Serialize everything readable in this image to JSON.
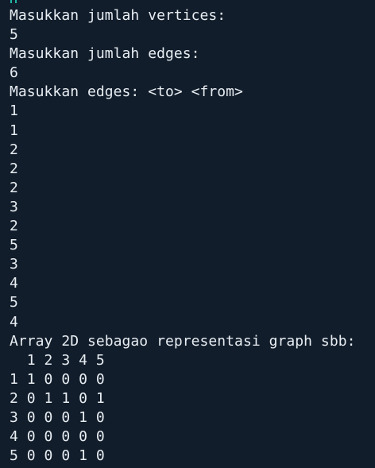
{
  "terminal": {
    "lines": [
      "Masukkan jumlah vertices:",
      "5",
      "Masukkan jumlah edges:",
      "6",
      "Masukkan edges: <to> <from>",
      "1",
      "1",
      "2",
      "2",
      "2",
      "3",
      "2",
      "5",
      "3",
      "4",
      "5",
      "4",
      "Array 2D sebagao representasi graph sbb:",
      "  1 2 3 4 5",
      "1 1 0 0 0 0",
      "2 0 1 1 0 1",
      "3 0 0 0 1 0",
      "4 0 0 0 0 0",
      "5 0 0 0 1 0"
    ]
  },
  "colors": {
    "background": "#111d2b",
    "text": "#e8edf2",
    "cursor": "#1fb7a5"
  }
}
